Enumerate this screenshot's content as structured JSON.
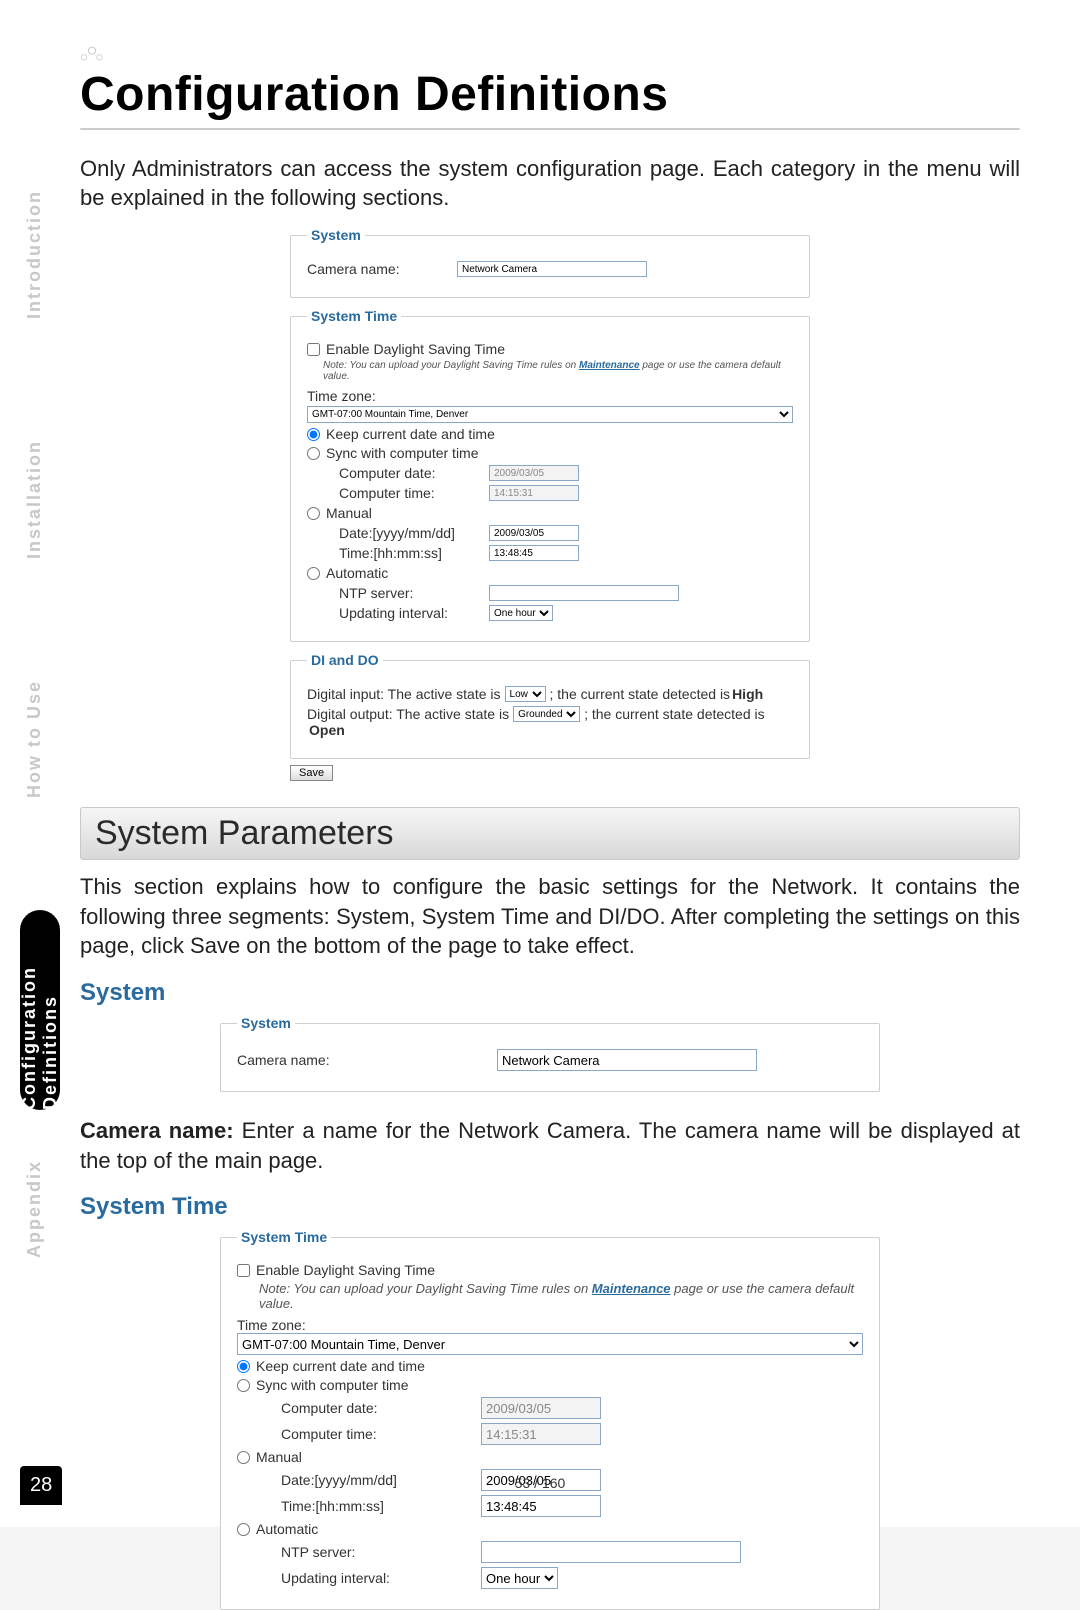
{
  "sidebar": {
    "items": [
      {
        "label": "Introduction"
      },
      {
        "label": "Installation"
      },
      {
        "label": "How to Use"
      },
      {
        "label": "Configuration\nDefinitions"
      },
      {
        "label": "Appendix"
      }
    ]
  },
  "header": {
    "title": "Configuration Definitions"
  },
  "intro": "Only Administrators can access the system configuration page. Each category in the menu will be explained in the following sections.",
  "systemFieldset": {
    "legend": "System",
    "cameraNameLabel": "Camera name:",
    "cameraNameValue": "Network Camera"
  },
  "systemTimeFieldset": {
    "legend": "System Time",
    "enableDst": "Enable Daylight Saving Time",
    "note_pre": "Note: You can upload your Daylight Saving Time rules on ",
    "note_link": "Maintenance",
    "note_post": " page or use the camera default value.",
    "timezoneLabel": "Time zone:",
    "timezoneValue": "GMT-07:00 Mountain Time, Denver",
    "optKeep": "Keep current date and time",
    "optSync": "Sync with computer time",
    "computerDateLabel": "Computer date:",
    "computerDateValue": "2009/03/05",
    "computerTimeLabel": "Computer time:",
    "computerTimeValue": "14:15:31",
    "optManual": "Manual",
    "manualDateLabel": "Date:[yyyy/mm/dd]",
    "manualDateValue": "2009/03/05",
    "manualTimeLabel": "Time:[hh:mm:ss]",
    "manualTimeValue": "13:48:45",
    "optAuto": "Automatic",
    "ntpLabel": "NTP server:",
    "ntpValue": "",
    "updLabel": "Updating interval:",
    "updValue": "One hour"
  },
  "diDoFieldset": {
    "legend": "DI and DO",
    "di_pre": "Digital input: The active state is ",
    "di_sel": "Low",
    "di_post": " ; the current state detected is ",
    "di_state": "High",
    "do_pre": "Digital output: The active state is ",
    "do_sel": "Grounded",
    "do_post": " ; the current state detected is ",
    "do_state": "Open",
    "saveBtn": "Save"
  },
  "sectionBar": "System Parameters",
  "sectionBody": "This section explains how to configure the basic settings for the Network. It contains the following three segments: System, System Time and DI/DO. After completing the settings on this page, click Save on the bottom of the page to take effect.",
  "subSystem": "System",
  "subSystemTime": "System Time",
  "cameraNameParaBold": "Camera name:",
  "cameraNamePara": " Enter a name for the Network Camera. The camera name will be displayed at the top of the main page.",
  "footer": {
    "pageOf": "53 / 160",
    "bookPage": "28"
  }
}
